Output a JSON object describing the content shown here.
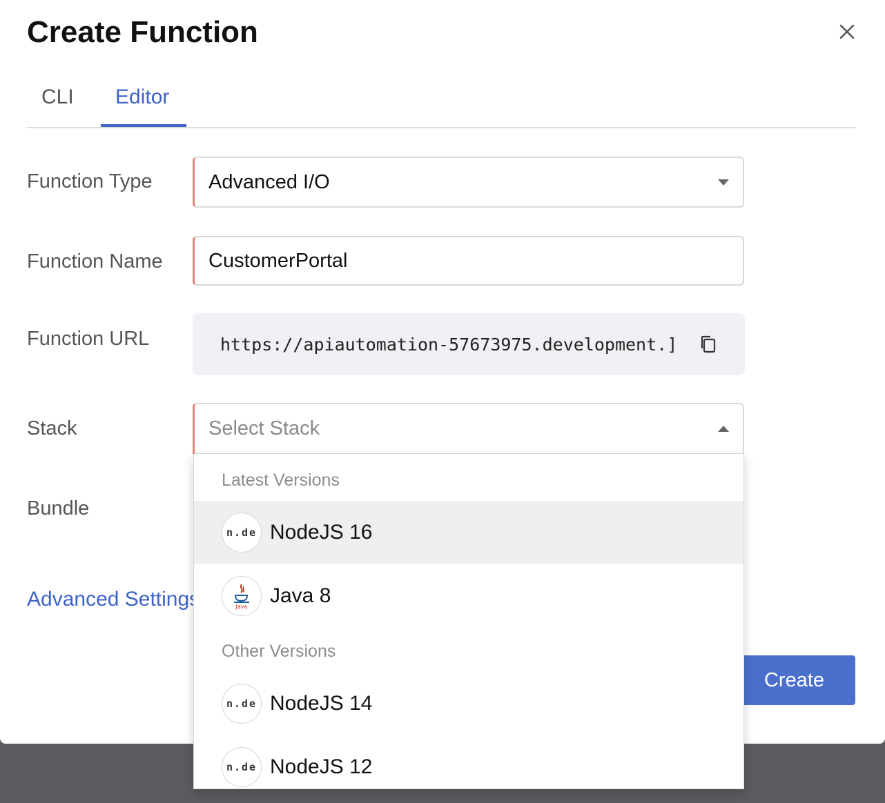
{
  "dialog": {
    "title": "Create Function"
  },
  "tabs": [
    {
      "label": "CLI",
      "active": false
    },
    {
      "label": "Editor",
      "active": true
    }
  ],
  "form": {
    "function_type": {
      "label": "Function Type",
      "value": "Advanced I/O"
    },
    "function_name": {
      "label": "Function Name",
      "value": "CustomerPortal"
    },
    "function_url": {
      "label": "Function URL",
      "value": "https://apiautomation-57673975.development.]"
    },
    "stack": {
      "label": "Stack",
      "placeholder": "Select Stack"
    },
    "bundle": {
      "label": "Bundle"
    },
    "advanced_settings": "Advanced Settings"
  },
  "stack_dropdown": {
    "groups": [
      {
        "header": "Latest Versions",
        "options": [
          {
            "label": "NodeJS 16",
            "icon": "nodejs-icon",
            "highlighted": true
          },
          {
            "label": "Java 8",
            "icon": "java-icon",
            "highlighted": false
          }
        ]
      },
      {
        "header": "Other Versions",
        "options": [
          {
            "label": "NodeJS 14",
            "icon": "nodejs-icon",
            "highlighted": false
          },
          {
            "label": "NodeJS 12",
            "icon": "nodejs-icon",
            "highlighted": false
          }
        ]
      }
    ]
  },
  "actions": {
    "create_label": "Create"
  },
  "colors": {
    "accent": "#3f64c6",
    "button": "#4a6fcc",
    "required_border": "#e3847d",
    "backdrop": "#5b5b60"
  },
  "icons": {
    "close": "close-icon",
    "copy": "copy-icon"
  }
}
